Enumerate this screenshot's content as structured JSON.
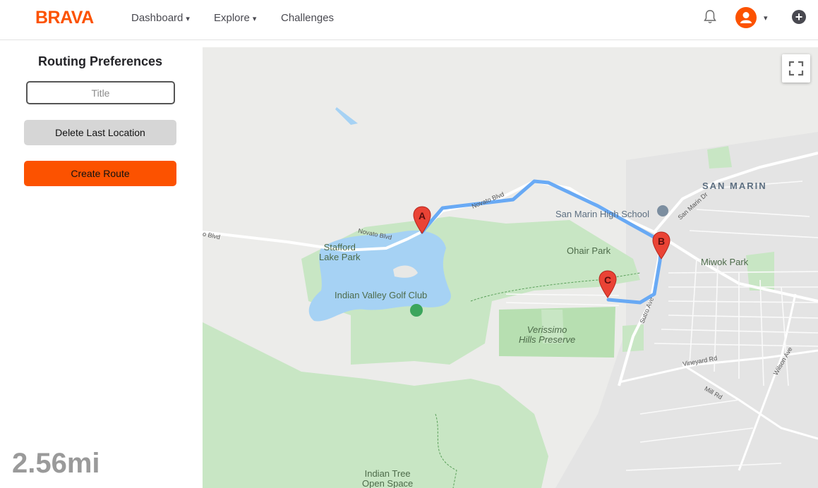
{
  "brand": {
    "logo": "BRAVA",
    "color": "#fc5200"
  },
  "nav": {
    "items": [
      {
        "label": "Dashboard",
        "caret": "▾"
      },
      {
        "label": "Explore",
        "caret": "▾"
      },
      {
        "label": "Challenges",
        "caret": ""
      }
    ],
    "icons": {
      "notifications": "bell-icon",
      "account": "user-icon",
      "account_caret": "▾",
      "add": "+"
    }
  },
  "panel": {
    "heading": "Routing Preferences",
    "title_field": {
      "value": "",
      "placeholder": "Title"
    },
    "delete_label": "Delete Last Location",
    "create_label": "Create Route",
    "distance": "2.56mi"
  },
  "map": {
    "labels": {
      "san_marin": "SAN MARIN",
      "high_school": "San Marin High School",
      "stafford_1": "Stafford",
      "stafford_2": "Lake Park",
      "golf": "Indian Valley Golf Club",
      "ohair": "Ohair Park",
      "miwok": "Miwok Park",
      "verissimo_1": "Verissimo",
      "verissimo_2": "Hills Preserve",
      "indian_tree_1": "Indian Tree",
      "indian_tree_2": "Open Space"
    },
    "roads": {
      "novato_blvd_1": "Novato Blvd",
      "novato_blvd_2": "Novato Blvd",
      "novato_blvd_3": "o Blvd",
      "san_marin_dr": "San Marin Dr",
      "sutro_ave": "Sutro Ave",
      "vineyard_rd": "Vineyard Rd",
      "mill_rd": "Mill Rd",
      "wilson_ave": "Wilson Ave"
    },
    "markers": [
      "A",
      "B",
      "C"
    ],
    "route_color": "#5aa2f5",
    "marker_color": "#ea4335"
  }
}
